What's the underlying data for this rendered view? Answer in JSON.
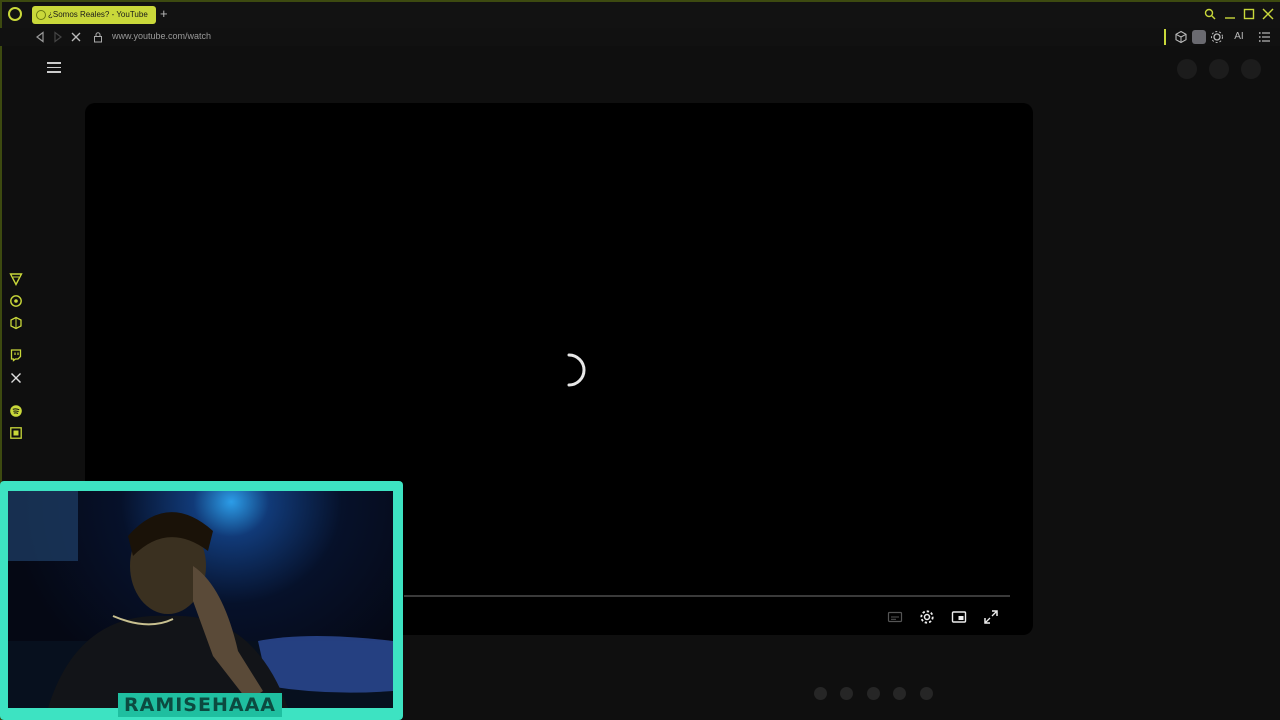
{
  "browser": {
    "tab_title": "¿Somos Reales? - YouTube",
    "url": "www.youtube.com/watch",
    "accent_color": "#c9d83a",
    "extensions": [
      {
        "icon": "cube-icon"
      },
      {
        "icon": "avatar-icon"
      },
      {
        "icon": "gear-extension-icon"
      },
      {
        "icon": "ai-icon",
        "label": "AI"
      },
      {
        "icon": "list-icon"
      }
    ]
  },
  "side_panel": {
    "icons": [
      "vivaldi-v-icon",
      "chatgpt-icon",
      "perplexity-icon",
      "twitch-icon",
      "x-icon",
      "spotify-icon",
      "translate-icon"
    ]
  },
  "player": {
    "state": "loading",
    "controls": [
      "subtitles-icon",
      "settings-icon",
      "miniplayer-icon",
      "fullscreen-icon"
    ]
  },
  "webcam": {
    "label": "RAMISEHAAA",
    "border_color": "#3de3c2"
  }
}
